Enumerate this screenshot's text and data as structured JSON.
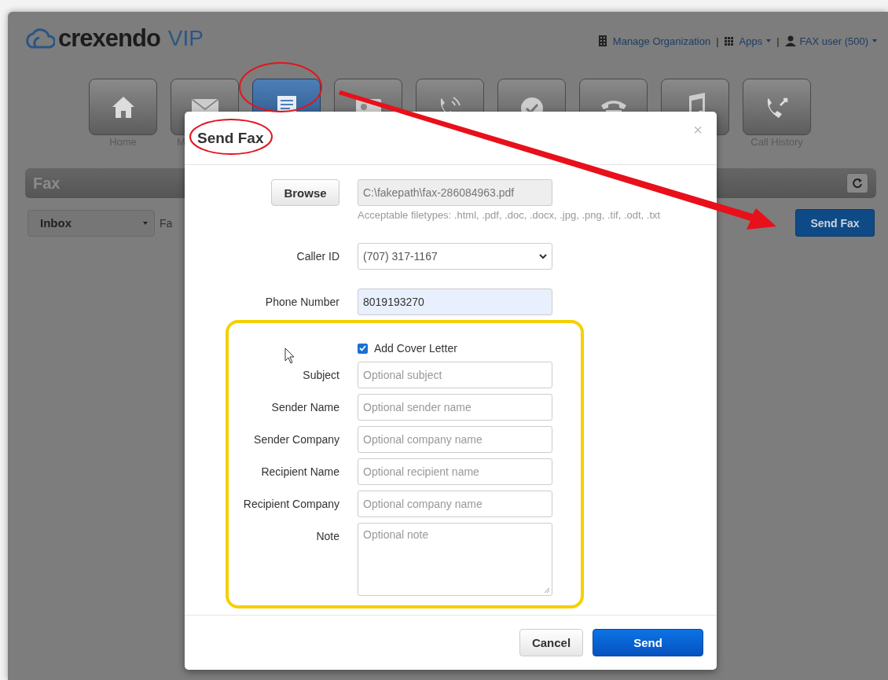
{
  "header": {
    "logo": "crexendo",
    "logo_suffix": "VIP",
    "separator": "|",
    "links": [
      {
        "label": "Manage Organization",
        "dropdown": false
      },
      {
        "label": "Apps",
        "dropdown": true
      },
      {
        "label": "FAX user (500)",
        "dropdown": true
      }
    ]
  },
  "nav_tiles": [
    {
      "label": "Home",
      "selected": false
    },
    {
      "label": "M",
      "selected": false
    },
    {
      "selected": true
    },
    {
      "selected": false
    },
    {
      "selected": false
    },
    {
      "selected": false
    },
    {
      "selected": false
    },
    {
      "selected": false
    },
    {
      "label": "Call History",
      "selected": false
    }
  ],
  "page": {
    "title": "Fax",
    "folder": "Inbox",
    "fragment": "Fa",
    "send_button": "Send Fax"
  },
  "modal": {
    "title": "Send Fax",
    "close": "×",
    "browse_button": "Browse",
    "file": "C:\\fakepath\\fax-286084963.pdf",
    "hint": "Acceptable filetypes: .html, .pdf, .doc, .docx, .jpg, .png, .tif, .odt, .txt",
    "caller_id": {
      "label": "Caller ID",
      "value": "(707) 317-1167"
    },
    "phone": {
      "label": "Phone Number",
      "value": "8019193270"
    },
    "cover_letter": {
      "label": "Add Cover Letter",
      "checked": true
    },
    "fields": [
      {
        "label": "Subject",
        "placeholder": "Optional subject",
        "kind": "input"
      },
      {
        "label": "Sender Name",
        "placeholder": "Optional sender name",
        "kind": "input"
      },
      {
        "label": "Sender Company",
        "placeholder": "Optional company name",
        "kind": "input"
      },
      {
        "label": "Recipient Name",
        "placeholder": "Optional recipient name",
        "kind": "input"
      },
      {
        "label": "Recipient Company",
        "placeholder": "Optional company name",
        "kind": "input"
      },
      {
        "label": "Note",
        "placeholder": "Optional note",
        "kind": "textarea"
      }
    ],
    "cancel_button": "Cancel",
    "send_button": "Send"
  }
}
